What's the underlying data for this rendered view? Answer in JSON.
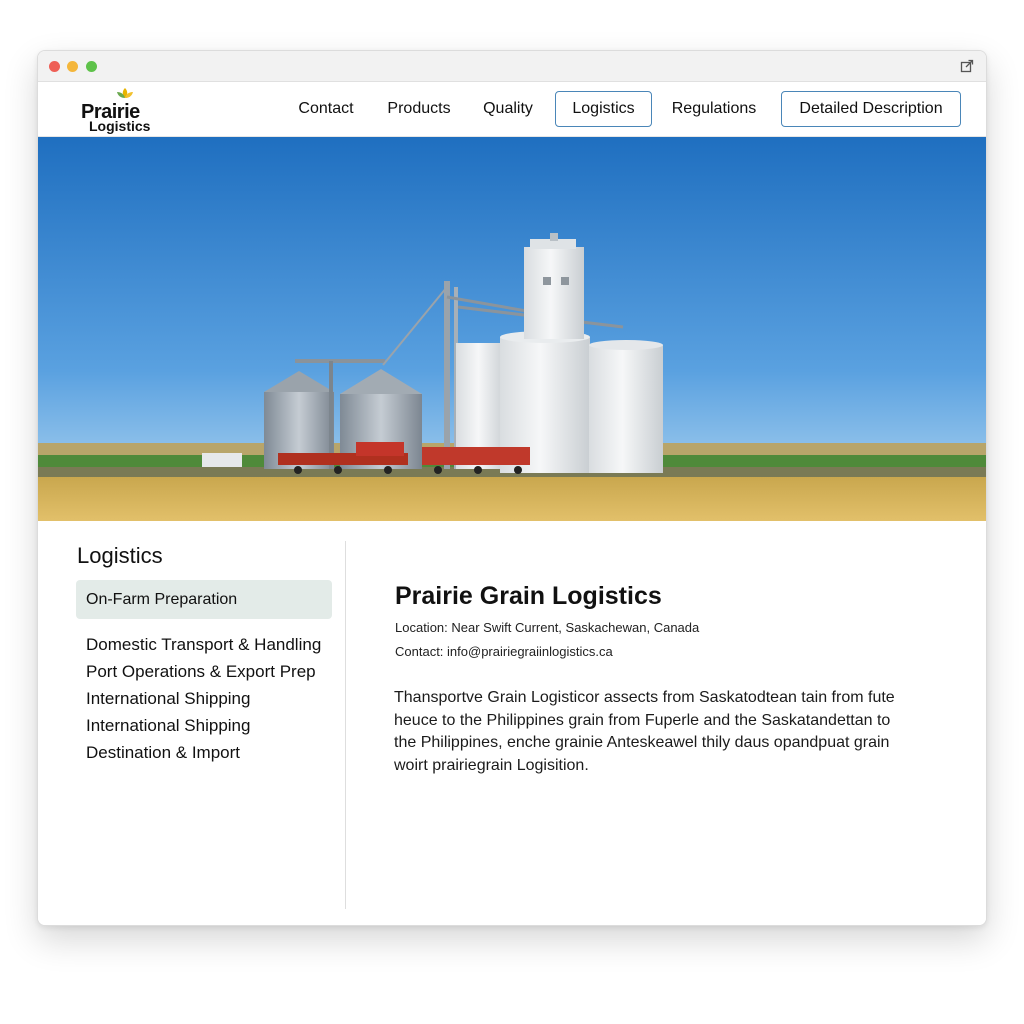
{
  "brand": {
    "name_line1": "Prairie",
    "name_line2": "Logistics"
  },
  "nav": {
    "items": [
      {
        "label": "Contact",
        "boxed": false
      },
      {
        "label": "Products",
        "boxed": false
      },
      {
        "label": "Quality",
        "boxed": false
      },
      {
        "label": "Logistics",
        "boxed": true
      },
      {
        "label": "Regulations",
        "boxed": false
      },
      {
        "label": "Detailed Description",
        "boxed": true
      }
    ]
  },
  "sidebar": {
    "title": "Logistics",
    "active_item": "On-Farm Preparation",
    "items": [
      "Domestic Transport & Handling",
      "Port Operations & Export Prep",
      "International Shipping",
      "International Shipping",
      "Destination & Import"
    ]
  },
  "main": {
    "title": "Prairie Grain Logistics",
    "location_label": "Location:",
    "location_value": "Near Swift Current, Saskachewan, Canada",
    "contact_label": "Contact:",
    "contact_value": "info@prairiegraiinlogistics.ca",
    "body": "Thansportve Grain Logisticor assects from Saskatodtean tain from fute heuce to the Philippines grain from Fuperle and the Saskatandettan to the Philippines, enche grainie Anteskeawel thily daus opandpuat grain woirt prairiegrain Logisition."
  },
  "colors": {
    "accent_border": "#4a86b8",
    "active_bg": "#e3ebe8",
    "sky_top": "#1f6fc0",
    "wheat": "#d7b45a"
  }
}
